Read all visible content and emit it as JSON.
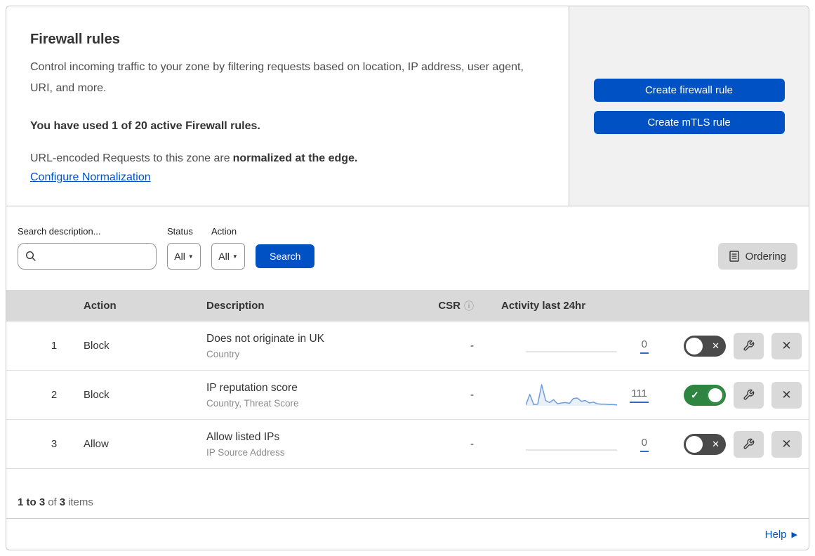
{
  "header": {
    "title": "Firewall rules",
    "description": "Control incoming traffic to your zone by filtering requests based on location, IP address, user agent, URI, and more.",
    "usage_notice": "You have used 1 of 20 active Firewall rules.",
    "normalization_prefix": "URL-encoded Requests to this zone are",
    "normalization_bold": "normalized at the edge.",
    "normalization_link": "Configure Normalization",
    "create_firewall_button": "Create firewall rule",
    "create_mtls_button": "Create mTLS rule"
  },
  "filters": {
    "search_label": "Search description...",
    "search_value": "",
    "status_label": "Status",
    "status_value": "All",
    "action_label": "Action",
    "action_value": "All",
    "search_button": "Search",
    "ordering_button": "Ordering"
  },
  "table": {
    "columns": {
      "action": "Action",
      "description": "Description",
      "csr": "CSR",
      "csr_info_icon": "ⓘ",
      "activity": "Activity last 24hr"
    },
    "rows": [
      {
        "number": "1",
        "action": "Block",
        "description": "Does not originate in UK",
        "criteria": "Country",
        "csr": "-",
        "activity_count": "0",
        "enabled": false,
        "sparkline": []
      },
      {
        "number": "2",
        "action": "Block",
        "description": "IP reputation score",
        "criteria": "Country, Threat Score",
        "csr": "-",
        "activity_count": "111",
        "enabled": true,
        "sparkline": [
          2,
          28,
          3,
          4,
          52,
          13,
          8,
          15,
          5,
          7,
          8,
          6,
          18,
          19,
          11,
          13,
          7,
          9,
          5,
          4,
          4,
          3,
          3,
          2
        ]
      },
      {
        "number": "3",
        "action": "Allow",
        "description": "Allow listed IPs",
        "criteria": "IP Source Address",
        "csr": "-",
        "activity_count": "0",
        "enabled": false,
        "sparkline": []
      }
    ]
  },
  "footer": {
    "range": "1 to 3",
    "of_text": "of",
    "total": "3",
    "items_text": "items",
    "help_label": "Help"
  },
  "colors": {
    "accent_blue": "#0051c3",
    "toggle_on_green": "#2e8540",
    "toggle_off_gray": "#4a4a4a",
    "sparkline_blue": "#6f9ce0",
    "sparkline_fill": "rgba(111,156,224,0.15)",
    "empty_line_gray": "#d4d4d4"
  }
}
